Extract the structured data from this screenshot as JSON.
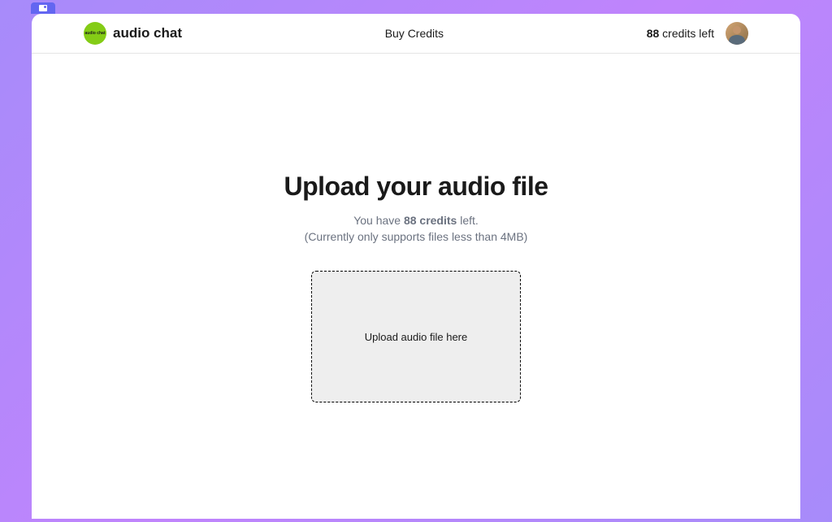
{
  "browserTab": {
    "icon": "window-icon"
  },
  "header": {
    "logo": {
      "text": "audio chat"
    },
    "brandName": "audio chat",
    "buyCredits": "Buy Credits",
    "credits": {
      "number": "88",
      "label": " credits left"
    }
  },
  "main": {
    "title": "Upload your audio file",
    "subtitle": {
      "prefix": "You have ",
      "creditsNumber": "88 credits",
      "suffix": " left.",
      "line2": "(Currently only supports files less than 4MB)"
    },
    "uploadZone": {
      "label": "Upload audio file here"
    }
  }
}
